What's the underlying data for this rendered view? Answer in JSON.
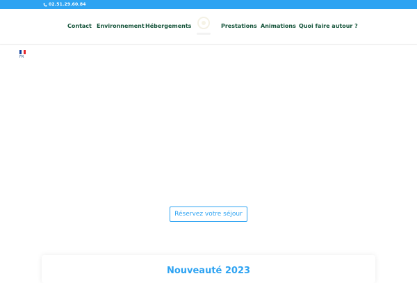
{
  "topbar": {
    "phone_icon": "phone-icon",
    "phone": "02.51.29.60.84",
    "color": "#2ea3f2"
  },
  "nav": {
    "items": [
      {
        "label": "Contact"
      },
      {
        "label": "Environnement"
      },
      {
        "label": "Hébergements"
      },
      {
        "label": "Prestations"
      },
      {
        "label": "Animations"
      },
      {
        "label": "Quoi faire autour ?"
      }
    ],
    "color": "#15543a"
  },
  "language": {
    "code": "FR",
    "flag_icon": "french-flag-icon"
  },
  "hero": {
    "cta_label": "Réservez votre séjour"
  },
  "card": {
    "title": "Nouveauté 2023"
  }
}
